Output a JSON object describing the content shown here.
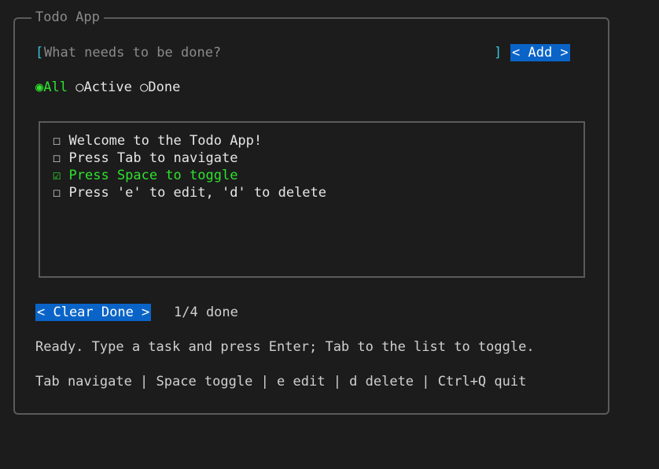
{
  "app": {
    "title": "Todo App"
  },
  "new_task": {
    "open_bracket": "[",
    "close_bracket": "]",
    "placeholder": "What needs to be done?",
    "value": "",
    "add_label": "< Add >"
  },
  "filters": {
    "selected": "All",
    "items": [
      {
        "mark": "◉",
        "label": "All"
      },
      {
        "mark": "○",
        "label": "Active"
      },
      {
        "mark": "○",
        "label": "Done"
      }
    ]
  },
  "todos": [
    {
      "checkbox": "☐",
      "text": "Welcome to the Todo App!",
      "done": false
    },
    {
      "checkbox": "☐",
      "text": "Press Tab to navigate",
      "done": false
    },
    {
      "checkbox": "☑",
      "text": "Press Space to toggle",
      "done": true
    },
    {
      "checkbox": "☐",
      "text": "Press 'e' to edit, 'd' to delete",
      "done": false
    }
  ],
  "footer": {
    "clear_done_label": "< Clear Done >",
    "done_count": "1/4 done",
    "status": "Ready. Type a task and press Enter; Tab to the list to toggle.",
    "help": "Tab navigate | Space toggle | e edit | d delete | Ctrl+Q quit"
  },
  "colors": {
    "background": "#1c1c1c",
    "accent_blue": "#0a64c8",
    "selected_green": "#2ee22e",
    "bracket_cyan": "#36c3d6",
    "border_gray": "#5a5a5a"
  }
}
